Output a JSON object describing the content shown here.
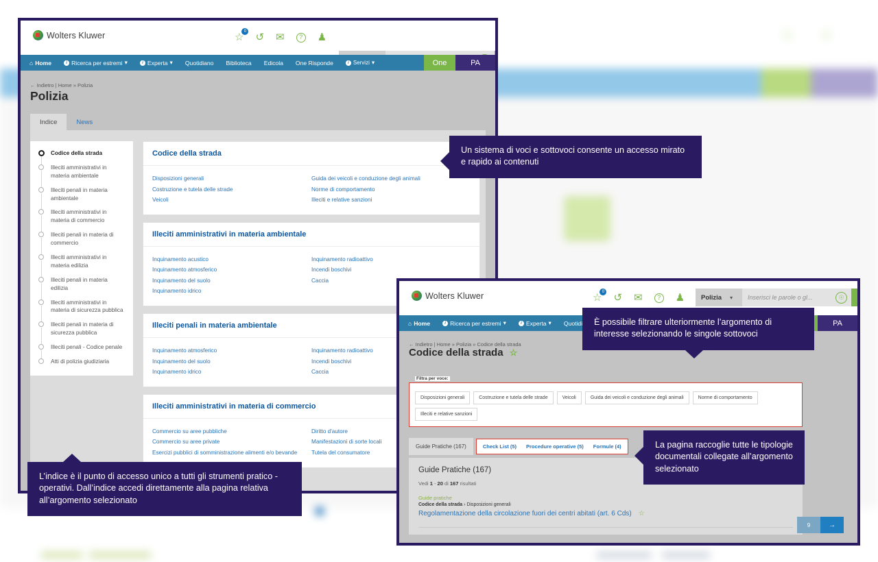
{
  "brand": {
    "name": "Wolters Kluwer"
  },
  "header": {
    "icons": [
      {
        "name": "favorites-star-icon",
        "glyph": "☆",
        "badge": "0"
      },
      {
        "name": "history-icon",
        "glyph": "↺",
        "badge": null
      },
      {
        "name": "mail-icon",
        "glyph": "✉",
        "badge": null
      },
      {
        "name": "help-icon",
        "glyph": "?",
        "badge": null
      },
      {
        "name": "user-icon",
        "glyph": "♟",
        "badge": null
      }
    ],
    "search": {
      "scope_value": "Polizia",
      "scope_caret": "⌄",
      "placeholder": "Inserisci le parole o gl...",
      "mic_icon": "Ἲ4",
      "go_icon": "⌕"
    }
  },
  "nav": {
    "items": [
      {
        "label": "Home",
        "icon": "home-icon",
        "bold": true,
        "info": false,
        "caret": false
      },
      {
        "label": "Ricerca per estremi",
        "bold": false,
        "info": true,
        "caret": true
      },
      {
        "label": "Experta",
        "bold": false,
        "info": true,
        "caret": true
      },
      {
        "label": "Quotidiano",
        "bold": false,
        "info": false,
        "caret": false
      },
      {
        "label": "Biblioteca",
        "bold": false,
        "info": false,
        "caret": false
      },
      {
        "label": "Edicola",
        "bold": false,
        "info": false,
        "caret": false
      },
      {
        "label": "One Risponde",
        "bold": false,
        "info": false,
        "caret": false
      },
      {
        "label": "Servizi",
        "bold": false,
        "info": true,
        "caret": true
      }
    ],
    "tab_one": "One",
    "tab_pa": "PA"
  },
  "window1": {
    "breadcrumb": "← Indietro | Home » Polizia",
    "title": "Polizia",
    "tabs": [
      {
        "label": "Indice",
        "active": true
      },
      {
        "label": "News",
        "active": false
      }
    ],
    "index_items": [
      {
        "label": "Codice della strada",
        "selected": true
      },
      {
        "label": "Illeciti amministrativi in materia ambientale",
        "selected": false
      },
      {
        "label": "Illeciti penali in materia ambientale",
        "selected": false
      },
      {
        "label": "Illeciti amministrativi in materia di commercio",
        "selected": false
      },
      {
        "label": "Illeciti penali in materia di commercio",
        "selected": false
      },
      {
        "label": "Illeciti amministrativi in materia edilizia",
        "selected": false
      },
      {
        "label": "Illeciti penali in materia edilizia",
        "selected": false
      },
      {
        "label": "Illeciti amministrativi in materia di sicurezza pubblica",
        "selected": false
      },
      {
        "label": "Illeciti penali in materia di sicurezza pubblica",
        "selected": false
      },
      {
        "label": "Illeciti penali - Codice penale",
        "selected": false
      },
      {
        "label": "Atti di polizia giudiziaria",
        "selected": false
      }
    ],
    "cards": [
      {
        "title": "Codice della strada",
        "col1": [
          "Disposizioni generali",
          "Costruzione e tutela delle strade",
          "Veicoli"
        ],
        "col2": [
          "Guida dei veicoli e conduzione degli animali",
          "Norme di comportamento",
          "Illeciti e relative sanzioni"
        ]
      },
      {
        "title": "Illeciti amministrativi in materia ambientale",
        "col1": [
          "Inquinamento acustico",
          "Inquinamento atmosferico",
          "Inquinamento del suolo",
          "Inquinamento idrico"
        ],
        "col2": [
          "Inquinamento radioattivo",
          "Incendi boschivi",
          "Caccia"
        ]
      },
      {
        "title": "Illeciti penali in materia ambientale",
        "col1": [
          "Inquinamento atmosferico",
          "Inquinamento del suolo",
          "Inquinamento idrico"
        ],
        "col2": [
          "Inquinamento radioattivo",
          "Incendi boschivi",
          "Caccia"
        ]
      },
      {
        "title": "Illeciti amministrativi in materia di commercio",
        "col1": [
          "Commercio su aree pubbliche",
          "Commercio su aree private",
          "Esercizi pubblici di somministrazione alimenti e/o bevande"
        ],
        "col2": [
          "Diritto d'autore",
          "Manifestazioni di sorte locali",
          "Tutela del consumatore"
        ]
      }
    ]
  },
  "window2": {
    "breadcrumb": "← Indietro | Home » Polizia » Codice della strada",
    "title": "Codice della strada",
    "title_star": "☆",
    "filter": {
      "label": "Filtra per voce:",
      "chips": [
        "Disposizioni generali",
        "Costruzione e tutela delle strade",
        "Veicoli",
        "Guida dei veicoli e conduzione degli animali",
        "Norme di comportamento",
        "Illeciti e relative sanzioni"
      ]
    },
    "doc_tabs": {
      "main": "Guide Pratiche (167)",
      "others": [
        "Check List (5)",
        "Procedure operative (5)",
        "Formule (4)"
      ]
    },
    "results": {
      "heading": "Guide Pratiche (167)",
      "count_prefix": "Vedi ",
      "count_from": "1",
      "count_dash": " - ",
      "count_to": "20",
      "count_mid": " di ",
      "count_total": "167",
      "count_suffix": " risultati",
      "items": [
        {
          "kind": "Guide pratiche",
          "path_bold": "Codice della strada",
          "path_rest": " › Disposizioni generali",
          "link": "Regolamentazione della circolazione fuori dei centri abitati (art. 6 Cds)",
          "star": "☆"
        }
      ]
    },
    "pager": {
      "page": "9",
      "next_icon": "→"
    }
  },
  "callouts": [
    {
      "id": "callout1",
      "text": "Un sistema di voci e sottovoci consente un accesso mirato e rapido ai contenuti"
    },
    {
      "id": "callout2",
      "text": "È possibile filtrare ulteriormente l’argomento di interesse selezionando le singole sottovoci"
    },
    {
      "id": "callout3",
      "text": "La pagina raccoglie tutte le tipologie documentali collegate all’argomento selezionato"
    },
    {
      "id": "callout4",
      "text": "L’indice è il punto di accesso unico a tutti gli strumenti pratico - operativi. Dall’indice accedi direttamente alla pagina relativa all’argomento selezionato"
    }
  ],
  "colors": {
    "navy": "#2a1a62",
    "nav_blue": "#2e7ca8",
    "green": "#7ab648",
    "link_blue": "#2a72b5",
    "card_title": "#0a56a0",
    "accent_red": "#e03c31"
  }
}
